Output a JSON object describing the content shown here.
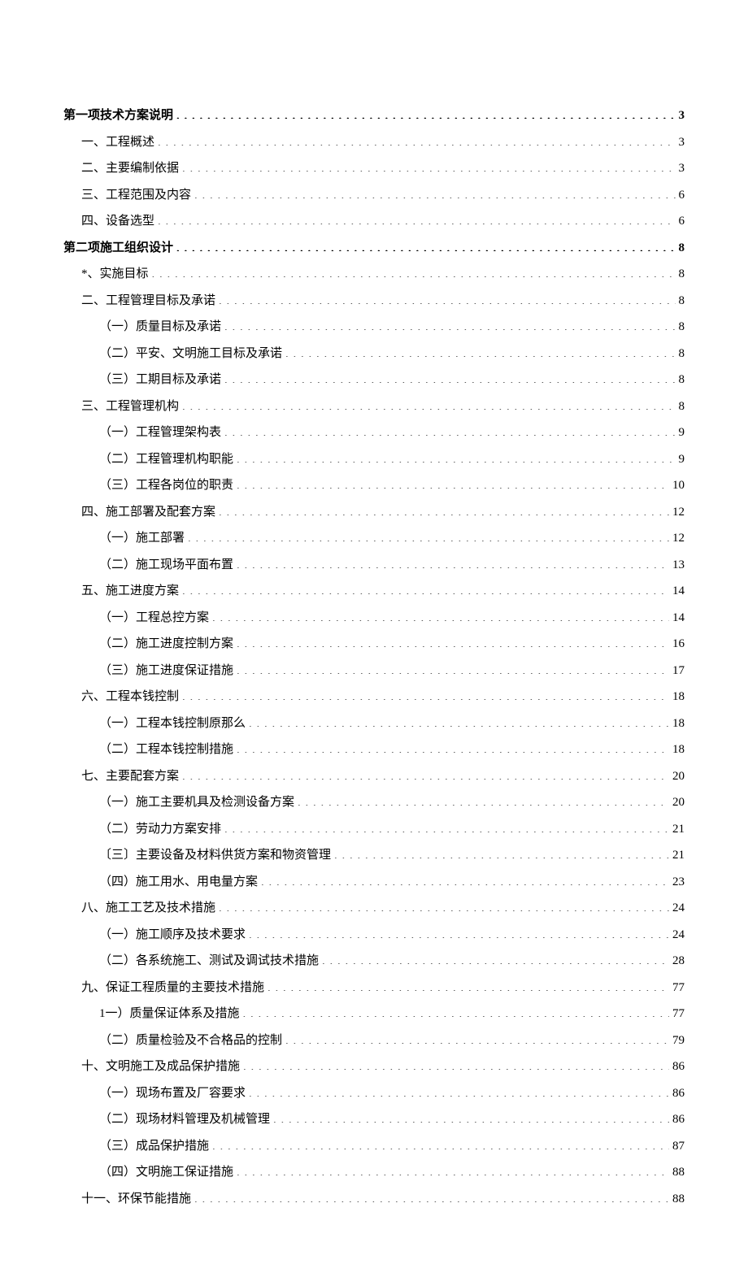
{
  "toc": [
    {
      "label": "第一项技术方案说明",
      "page": "3",
      "level": 0
    },
    {
      "label": "一、工程概述",
      "page": "3",
      "level": 1
    },
    {
      "label": "二、主要编制依据",
      "page": "3",
      "level": 1
    },
    {
      "label": "三、工程范围及内容",
      "page": "6",
      "level": 1
    },
    {
      "label": "四、设备选型",
      "page": "6",
      "level": 1
    },
    {
      "label": "第二项施工组织设计",
      "page": "8",
      "level": 0
    },
    {
      "label": "*、实施目标",
      "page": "8",
      "level": 1
    },
    {
      "label": "二、工程管理目标及承诺",
      "page": "8",
      "level": 1
    },
    {
      "label": "（一）质量目标及承诺",
      "page": "8",
      "level": 2
    },
    {
      "label": "（二）平安、文明施工目标及承诺",
      "page": "8",
      "level": 2
    },
    {
      "label": "（三）工期目标及承诺",
      "page": "8",
      "level": 2
    },
    {
      "label": "三、工程管理机构",
      "page": "8",
      "level": 1
    },
    {
      "label": "（一）工程管理架构表",
      "page": "9",
      "level": 2
    },
    {
      "label": "（二）工程管理机构职能",
      "page": "9",
      "level": 2
    },
    {
      "label": "（三）工程各岗位的职责",
      "page": "10",
      "level": 2
    },
    {
      "label": "四、施工部署及配套方案",
      "page": "12",
      "level": 1
    },
    {
      "label": "（一）施工部署",
      "page": "12",
      "level": 2
    },
    {
      "label": "（二）施工现场平面布置",
      "page": "13",
      "level": 2
    },
    {
      "label": "五、施工进度方案",
      "page": "14",
      "level": 1
    },
    {
      "label": "（一）工程总控方案",
      "page": "14",
      "level": 2
    },
    {
      "label": "（二）施工进度控制方案",
      "page": "16",
      "level": 2
    },
    {
      "label": "（三）施工进度保证措施",
      "page": "17",
      "level": 2
    },
    {
      "label": "六、工程本钱控制",
      "page": "18",
      "level": 1
    },
    {
      "label": "（一）工程本钱控制原那么",
      "page": "18",
      "level": 2
    },
    {
      "label": "（二）工程本钱控制措施",
      "page": "18",
      "level": 2
    },
    {
      "label": "七、主要配套方案",
      "page": "20",
      "level": 1
    },
    {
      "label": "（一）施工主要机具及检测设备方案",
      "page": "20",
      "level": 2
    },
    {
      "label": "（二）劳动力方案安排",
      "page": "21",
      "level": 2
    },
    {
      "label": "〔三〕主要设备及材料供货方案和物资管理",
      "page": "21",
      "level": 2
    },
    {
      "label": "（四）施工用水、用电量方案",
      "page": "23",
      "level": 2
    },
    {
      "label": "八、施工工艺及技术措施",
      "page": "24",
      "level": 1
    },
    {
      "label": "（一）施工顺序及技术要求",
      "page": "24",
      "level": 2
    },
    {
      "label": "（二）各系统施工、测试及调试技术措施",
      "page": "28",
      "level": 2
    },
    {
      "label": "九、保证工程质量的主要技术措施",
      "page": "77",
      "level": 1
    },
    {
      "label": "1一）质量保证体系及措施",
      "page": "77",
      "level": 2
    },
    {
      "label": "（二）质量检验及不合格品的控制",
      "page": "79",
      "level": 2
    },
    {
      "label": "十、文明施工及成品保护措施",
      "page": "86",
      "level": 1
    },
    {
      "label": "（一）现场布置及厂容要求",
      "page": "86",
      "level": 2
    },
    {
      "label": "（二）现场材料管理及机械管理",
      "page": "86",
      "level": 2
    },
    {
      "label": "（三）成品保护措施",
      "page": "87",
      "level": 2
    },
    {
      "label": "（四）文明施工保证措施",
      "page": "88",
      "level": 2
    },
    {
      "label": "十一、环保节能措施",
      "page": "88",
      "level": 1
    }
  ]
}
